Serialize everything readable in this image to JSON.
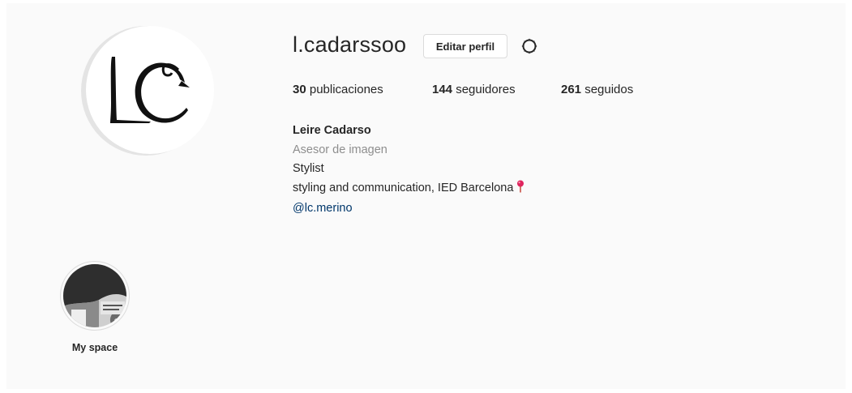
{
  "profile": {
    "username": "l.cadarssoo",
    "edit_label": "Editar perfil",
    "avatar_text": "LC"
  },
  "stats": {
    "posts_count": "30",
    "posts_label": " publicaciones",
    "followers_count": "144",
    "followers_label": " seguidores",
    "following_count": "261",
    "following_label": " seguidos"
  },
  "bio": {
    "full_name": "Leire Cadarso",
    "category": "Asesor de imagen",
    "line1": "Stylist",
    "line2": "styling and communication, IED Barcelona",
    "link": "@lc.merino"
  },
  "highlights": [
    {
      "label": "My space"
    }
  ],
  "icons": {
    "settings": "gear-icon",
    "location": "round-pushpin-icon"
  },
  "colors": {
    "background": "#fafafa",
    "link": "#00376b",
    "secondary_text": "#8e8e8e",
    "pin": "#e0245e"
  }
}
